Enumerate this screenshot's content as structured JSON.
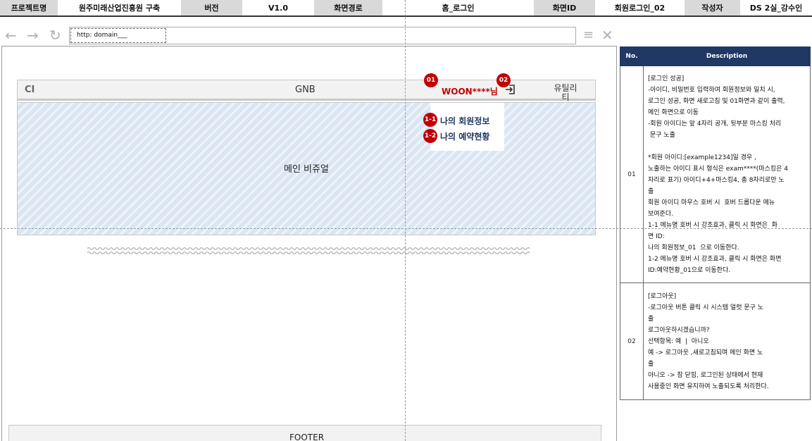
{
  "header": {
    "project_label": "프로젝트명",
    "project_value": "원주미래산업진흥원 구축",
    "version_label": "버전",
    "version_value": "V1.0",
    "path_label": "화면경로",
    "path_value": "홈_로그인",
    "screen_id_label": "화면ID",
    "screen_id_value": "회원로그인_02",
    "author_label": "작성자",
    "author_value": "DS 2실_강수인"
  },
  "browser": {
    "back_icon": "back-arrow-icon",
    "forward_icon": "forward-arrow-icon",
    "refresh_icon": "refresh-icon",
    "url": "http: domain___",
    "menu_icon": "hamburger-icon",
    "close_icon": "close-icon"
  },
  "gnb": {
    "ci": "CI",
    "menu": "GNB",
    "user_name": "WOON****님",
    "logout_icon": "logout-icon",
    "utility": "유틸리티"
  },
  "dropdown": {
    "items": [
      {
        "label": "나의 회원정보",
        "badge": "1-1"
      },
      {
        "label": "나의 예약현황",
        "badge": "1-2"
      }
    ]
  },
  "badges": {
    "user": "01",
    "logout": "02"
  },
  "main_visual": "메인 비쥬얼",
  "footer": "FOOTER",
  "colors": {
    "accent_red": "#c00000",
    "navy": "#1f3864",
    "visual_blue": "#dbe6f3"
  },
  "description": {
    "col_no": "No.",
    "col_desc": "Description",
    "rows": [
      {
        "no": "01",
        "text": "[로그인 성공]\n-아이디, 비밀번호 입력하여 회원정보와 일치 시,\n로그인 성공, 화면 새로고침 및 01화면과 같이 출력,\n메인 화면으로 이동\n-회원 아이디는 앞 4자리 공개, 뒷부분 마스킹 처리\n 문구 노출\n\n*회원 아이디:[example1234]일 경우 ,\n노출하는 아이디 표시 형식은 exam****(마스킹은 4\n자리로 표기) 아이디+4+마스킹4, 총 8자리로만 노\n출\n회원 아이디 마우스 호버 시  호버 드롭다운 메뉴\n보여준다.\n1-1 메뉴명 호버 시 강조효과, 클릭 시 화면은  화\n면 ID:\n나의 회원정보_01  으로 이동한다.\n1-2 메뉴명 호버 시 강조효과, 클릭 시 화면은 화면\nID:예약현황_01으로 이동한다."
      },
      {
        "no": "02",
        "text": "[로그아웃]\n-로그아웃 버튼 클릭 시 시스템 얼럿 문구 노\n출\n로그아웃하시겠습니까?\n선택항목: 예  |  아니오\n예 -> 로그아웃 ,새로고침되며 메인 화면 노\n출\n아니오 -> 창 닫힘, 로그인된 상태에서 현재\n사용중인 화면 유지하여 노출되도록 처리한다."
      }
    ]
  }
}
